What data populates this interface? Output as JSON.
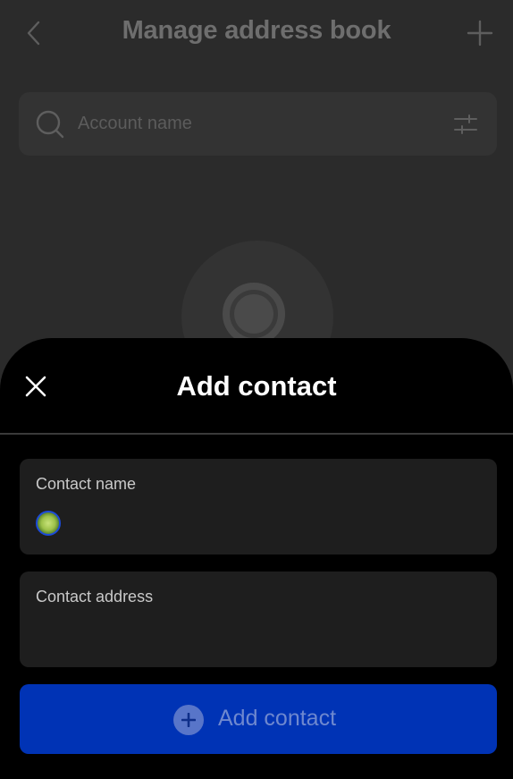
{
  "background_page": {
    "title": "Manage address book",
    "search_placeholder": "Account name"
  },
  "sheet": {
    "title": "Add contact",
    "fields": [
      {
        "label": "Contact name",
        "value": ""
      },
      {
        "label": "Contact address",
        "value": ""
      }
    ],
    "submit_label": "Add contact"
  },
  "colors": {
    "accent": "#0033b5",
    "sheet_bg": "#000000",
    "field_bg": "#1e1e1e"
  },
  "icons": {
    "back": "chevron-left-icon",
    "add": "plus-icon",
    "search": "search-icon",
    "filter": "filter-sliders-icon",
    "close": "close-icon"
  }
}
